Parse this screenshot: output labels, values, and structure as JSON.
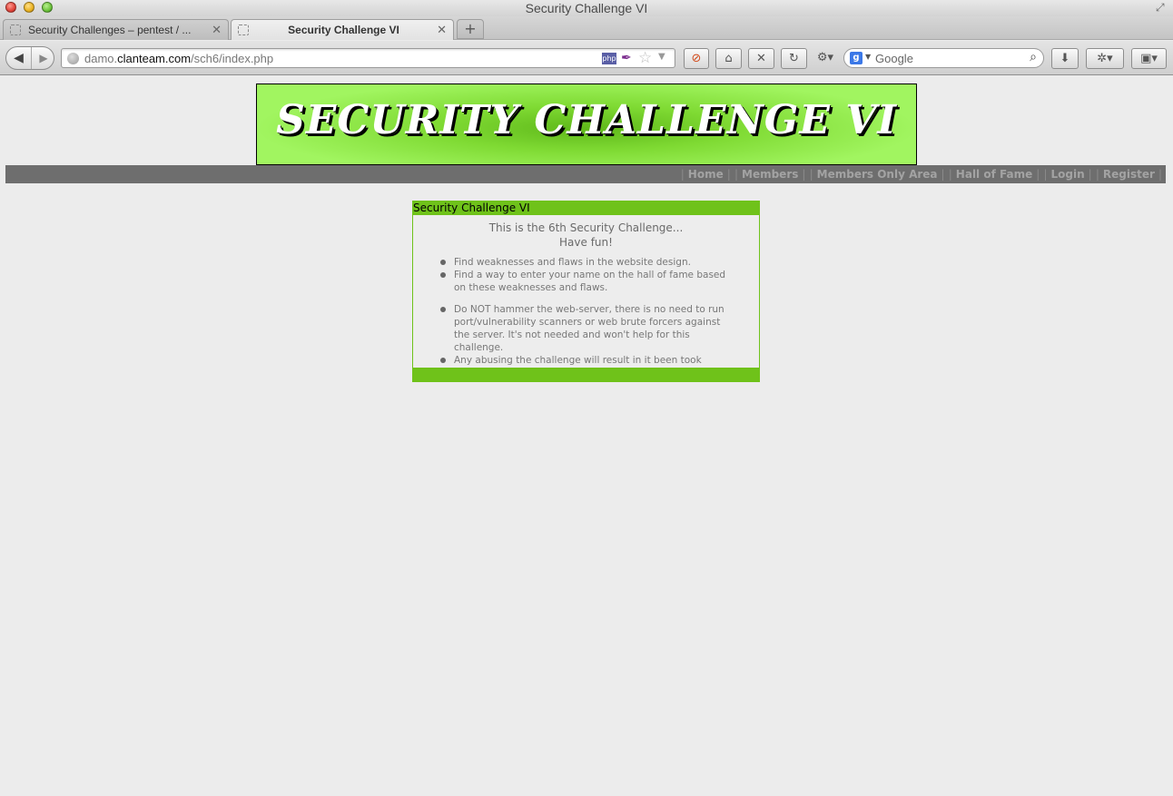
{
  "window": {
    "title": "Security Challenge VI"
  },
  "tabs": [
    {
      "label": "Security Challenges – pentest / ...",
      "active": false
    },
    {
      "label": "Security Challenge VI",
      "active": true
    }
  ],
  "toolbar": {
    "url_prefix": "damo.",
    "url_domain": "clanteam.com",
    "url_path": "/sch6/index.php",
    "php_badge": "php",
    "search_placeholder": "Google",
    "icons": [
      "back-icon",
      "forward-icon",
      "globe-icon",
      "php-icon",
      "quill-icon",
      "bookmark-star-icon",
      "block-icon",
      "home-icon",
      "stop-icon",
      "reload-icon",
      "addon-icon",
      "google-icon",
      "search-icon",
      "download-icon",
      "tools-icon",
      "bookmarks-icon"
    ]
  },
  "banner": {
    "text": "SECURITY CHALLENGE VI"
  },
  "menu": {
    "items": [
      "Home",
      "Members",
      "Members Only Area",
      "Hall of Fame",
      "Login",
      "Register"
    ]
  },
  "content": {
    "box_title": "Security Challenge VI",
    "intro_line1": "This is the 6th Security Challenge...",
    "intro_line2": "Have fun!",
    "rules": [
      "Find weaknesses and flaws in the website design.",
      "Find a way to enter your name on the hall of fame based on these weaknesses and flaws.",
      "Do NOT hammer the web-server, there is no need to run port/vulnerability scanners or web brute forcers against the server. It's not needed and won't help for this challenge.",
      "Any abusing the challenge will result in it been took offline."
    ]
  },
  "colors": {
    "accent": "#6fc21a",
    "menubar": "#6e6e6e",
    "page_bg": "#ececec"
  }
}
